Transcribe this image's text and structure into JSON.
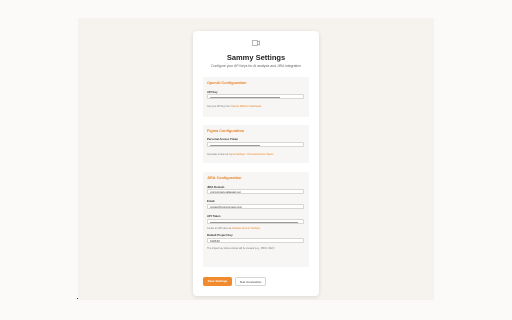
{
  "header": {
    "title": "Sammy Settings",
    "subtitle": "Configure your API keys for AI analysis and JIRA integration"
  },
  "openai": {
    "title": "OpenAI Configuration",
    "api_key_label": "API Key",
    "help_prefix": "Get your API key from ",
    "help_link": "OpenAI Platform Dashboard"
  },
  "figma": {
    "title": "Figma Configuration",
    "token_label": "Personal Access Token",
    "help_prefix": "Generate a token at ",
    "help_link": "Figma Settings > Personal Access Tokens"
  },
  "jira": {
    "title": "JIRA Configuration",
    "domain_label": "JIRA Domain",
    "domain_value": "yourcompany.atlassian.net",
    "email_label": "Email",
    "email_value": "contact@yourcompany.com",
    "token_label": "API Token",
    "token_help_prefix": "Create an API token at ",
    "token_help_link": "Atlassian Account Settings",
    "project_label": "Default Project Key",
    "project_value": "SCRUM",
    "project_help": "The project key where stories will be created (e.g., PROJ, DEV)"
  },
  "actions": {
    "save_label": "Save Settings",
    "test_label": "Test Connection"
  },
  "colors": {
    "accent": "#e8842a",
    "primary_button": "#f08a2c"
  },
  "icons": {
    "logo": "sammy-logo-icon"
  }
}
